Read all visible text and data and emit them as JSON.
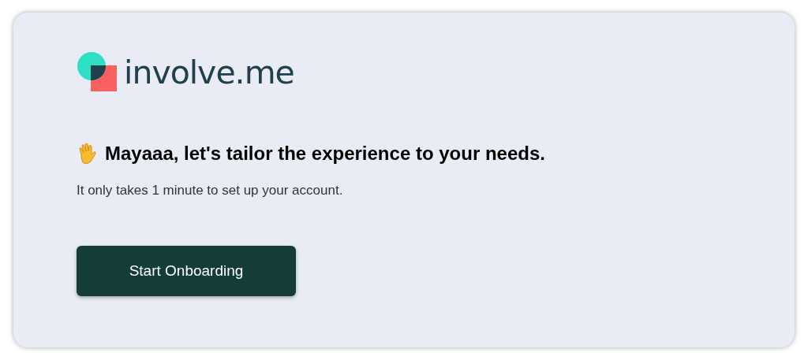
{
  "logo": {
    "text": "involve.me"
  },
  "heading": "Mayaaa, let's tailor the experience to your needs.",
  "subtitle": "It only takes 1 minute to set up your account.",
  "button": {
    "label": "Start Onboarding"
  }
}
